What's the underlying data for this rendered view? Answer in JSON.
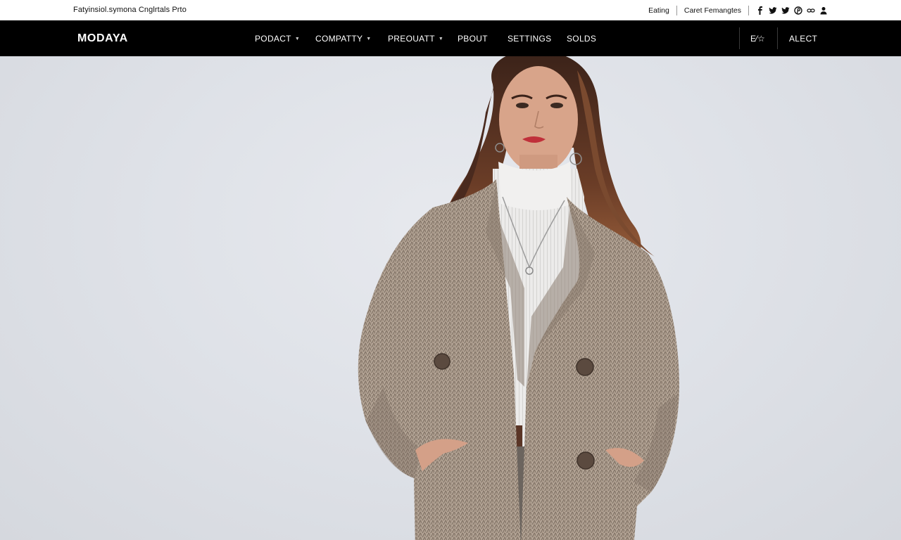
{
  "topbar": {
    "tagline": "Fatyinsiol.symona Cnglrtals Prto",
    "link_1": "Eating",
    "link_2": "Caret Femangtes",
    "social_icons": [
      "facebook-icon",
      "twitter-icon",
      "twitter-icon",
      "pinterest-icon",
      "link-icon",
      "user-icon"
    ]
  },
  "nav": {
    "logo": "MODAYA",
    "items": [
      {
        "label": "PODACT",
        "dropdown": true
      },
      {
        "label": "COMPATTY",
        "dropdown": true
      },
      {
        "label": "PREOUATT",
        "dropdown": true
      },
      {
        "label": "PBOUT",
        "dropdown": false
      },
      {
        "label": "SETTINGS",
        "dropdown": false
      },
      {
        "label": "SOLDS",
        "dropdown": false
      }
    ],
    "lang": "E⁄☆",
    "alect": "ALECT"
  },
  "hero": {
    "image": "model-in-tweed-coat",
    "colors": {
      "background": "#dfe2e8",
      "coat": "#a9998a",
      "sweater": "#ecebea",
      "hair": "#5a3526",
      "skin": "#d8a48a"
    }
  },
  "theme": {
    "navbar_bg": "#000000",
    "topbar_bg": "#ffffff",
    "nav_text": "#ffffff"
  }
}
